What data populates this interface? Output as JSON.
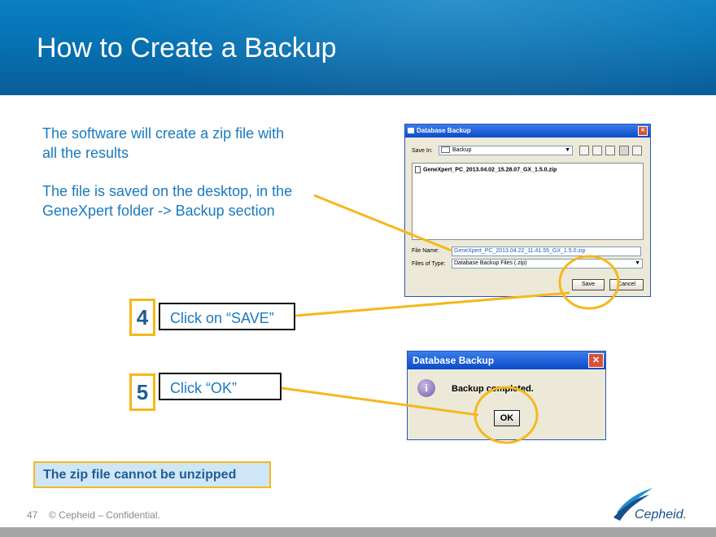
{
  "slide": {
    "title": "How to Create a Backup",
    "paragraph1_line1": "The software will create a zip file with",
    "paragraph1_line2": "all the results",
    "paragraph2_line1": "The file is saved on the desktop, in the",
    "paragraph2_line2": "GeneXpert folder -> Backup section",
    "step4_number": "4",
    "step4_text": "Click on “SAVE”",
    "step5_number": "5",
    "step5_text": "Click “OK”",
    "warning": "The zip file cannot be unzipped",
    "page_number": "47",
    "footer": "© Cepheid – Confidential.",
    "logo_text": "Cepheid."
  },
  "backup_dialog": {
    "title": "Database Backup",
    "close_glyph": "✕",
    "save_in_label": "Save In:",
    "save_in_value": "Backup",
    "file_entry": "GeneXpert_PC_2013.04.02_15.28.07_GX_1.5.0.zip",
    "file_name_label": "File Name:",
    "file_name_value": "GeneXpert_PC_2013.04.22_11.41.55_GX_1.5.0.zip",
    "files_of_type_label": "Files of Type:",
    "files_of_type_value": "Database Backup Files (.zip)",
    "save_button": "Save",
    "cancel_button": "Cancel"
  },
  "completed_dialog": {
    "title": "Database Backup",
    "close_glyph": "✕",
    "message": "Backup completed.",
    "ok_button": "OK",
    "icon_glyph": "i"
  },
  "colors": {
    "header_blue": "#0672b3",
    "text_blue": "#1a7abf",
    "highlight_yellow": "#f5b81c",
    "step_number_blue": "#1f5d95"
  }
}
